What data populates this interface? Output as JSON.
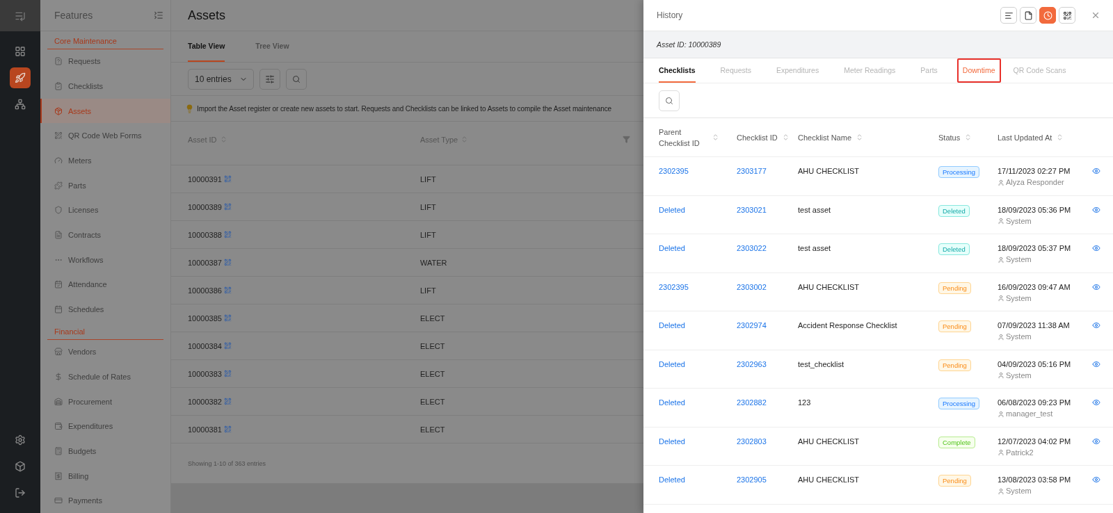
{
  "rail": {
    "top": [
      {
        "selected": false
      },
      {
        "selected": true
      },
      {
        "selected": false
      }
    ],
    "bottom": [
      {
        "selected": false
      },
      {
        "selected": false
      },
      {
        "selected": false
      }
    ]
  },
  "sidebar": {
    "title": "Features",
    "sections": [
      {
        "title": "Core Maintenance",
        "items": [
          {
            "label": "Requests",
            "selected": false
          },
          {
            "label": "Checklists",
            "selected": false
          },
          {
            "label": "Assets",
            "selected": true
          },
          {
            "label": "QR Code Web Forms",
            "selected": false
          },
          {
            "label": "Meters",
            "selected": false
          },
          {
            "label": "Parts",
            "selected": false
          },
          {
            "label": "Licenses",
            "selected": false
          },
          {
            "label": "Contracts",
            "selected": false
          },
          {
            "label": "Workflows",
            "selected": false
          },
          {
            "label": "Attendance",
            "selected": false
          },
          {
            "label": "Schedules",
            "selected": false
          }
        ]
      },
      {
        "title": "Financial",
        "items": [
          {
            "label": "Vendors",
            "selected": false
          },
          {
            "label": "Schedule of Rates",
            "selected": false
          },
          {
            "label": "Procurement",
            "selected": false
          },
          {
            "label": "Expenditures",
            "selected": false
          },
          {
            "label": "Budgets",
            "selected": false
          },
          {
            "label": "Billing",
            "selected": false
          },
          {
            "label": "Payments",
            "selected": false
          }
        ]
      }
    ]
  },
  "main": {
    "title": "Assets",
    "view_tabs": [
      {
        "label": "Table View",
        "selected": true
      },
      {
        "label": "Tree View",
        "selected": false
      }
    ],
    "entries_select": "10 entries",
    "info": "Import the Asset register or create new assets to start. Requests and Checklists can be linked to Assets to compile the Asset maintenance",
    "columns": [
      "Asset ID",
      "Asset Type"
    ],
    "rows": [
      {
        "asset_id": "10000391",
        "asset_type": "LIFT"
      },
      {
        "asset_id": "10000389",
        "asset_type": "LIFT"
      },
      {
        "asset_id": "10000388",
        "asset_type": "LIFT"
      },
      {
        "asset_id": "10000387",
        "asset_type": "WATER"
      },
      {
        "asset_id": "10000386",
        "asset_type": "LIFT"
      },
      {
        "asset_id": "10000385",
        "asset_type": "ELECT"
      },
      {
        "asset_id": "10000384",
        "asset_type": "ELECT"
      },
      {
        "asset_id": "10000383",
        "asset_type": "ELECT"
      },
      {
        "asset_id": "10000382",
        "asset_type": "ELECT"
      },
      {
        "asset_id": "10000381",
        "asset_type": "ELECT"
      }
    ],
    "footer": "Showing 1-10 of 363 entries"
  },
  "drawer": {
    "title": "History",
    "toolbar": [
      {
        "selected": false
      },
      {
        "selected": false
      },
      {
        "selected": true
      },
      {
        "selected": false
      }
    ],
    "asset_id": "Asset ID: 10000389",
    "tabs": [
      {
        "label": "Checklists",
        "selected": true,
        "highlighted": false
      },
      {
        "label": "Requests",
        "selected": false,
        "highlighted": false
      },
      {
        "label": "Expenditures",
        "selected": false,
        "highlighted": false
      },
      {
        "label": "Meter Readings",
        "selected": false,
        "highlighted": false
      },
      {
        "label": "Parts",
        "selected": false,
        "highlighted": false
      },
      {
        "label": "Downtime",
        "selected": false,
        "highlighted": true
      },
      {
        "label": "QR Code Scans",
        "selected": false,
        "highlighted": false
      }
    ],
    "columns": [
      "Parent Checklist ID",
      "Checklist ID",
      "Checklist Name",
      "Status",
      "Last Updated At"
    ],
    "rows": [
      {
        "parent_id": "2302395",
        "checklist_id": "2303177",
        "name": "AHU CHECKLIST",
        "status": {
          "label": "Processing",
          "kind": "processing"
        },
        "updated_at": "17/11/2023 02:27 PM",
        "user": "Alyza Responder"
      },
      {
        "parent_id": "Deleted",
        "checklist_id": "2303021",
        "name": "test asset",
        "status": {
          "label": "Deleted",
          "kind": "deleted"
        },
        "updated_at": "18/09/2023 05:36 PM",
        "user": "System"
      },
      {
        "parent_id": "Deleted",
        "checklist_id": "2303022",
        "name": "test asset",
        "status": {
          "label": "Deleted",
          "kind": "deleted"
        },
        "updated_at": "18/09/2023 05:37 PM",
        "user": "System"
      },
      {
        "parent_id": "2302395",
        "checklist_id": "2303002",
        "name": "AHU CHECKLIST",
        "status": {
          "label": "Pending",
          "kind": "pending"
        },
        "updated_at": "16/09/2023 09:47 AM",
        "user": "System"
      },
      {
        "parent_id": "Deleted",
        "checklist_id": "2302974",
        "name": "Accident Response Checklist",
        "status": {
          "label": "Pending",
          "kind": "pending"
        },
        "updated_at": "07/09/2023 11:38 AM",
        "user": "System"
      },
      {
        "parent_id": "Deleted",
        "checklist_id": "2302963",
        "name": "test_checklist",
        "status": {
          "label": "Pending",
          "kind": "pending"
        },
        "updated_at": "04/09/2023 05:16 PM",
        "user": "System"
      },
      {
        "parent_id": "Deleted",
        "checklist_id": "2302882",
        "name": "123",
        "status": {
          "label": "Processing",
          "kind": "processing"
        },
        "updated_at": "06/08/2023 09:23 PM",
        "user": "manager_test"
      },
      {
        "parent_id": "Deleted",
        "checklist_id": "2302803",
        "name": "AHU CHECKLIST",
        "status": {
          "label": "Complete",
          "kind": "complete"
        },
        "updated_at": "12/07/2023 04:02 PM",
        "user": "Patrick2"
      },
      {
        "parent_id": "Deleted",
        "checklist_id": "2302905",
        "name": "AHU CHECKLIST",
        "status": {
          "label": "Pending",
          "kind": "pending"
        },
        "updated_at": "13/08/2023 03:58 PM",
        "user": "System"
      }
    ]
  }
}
